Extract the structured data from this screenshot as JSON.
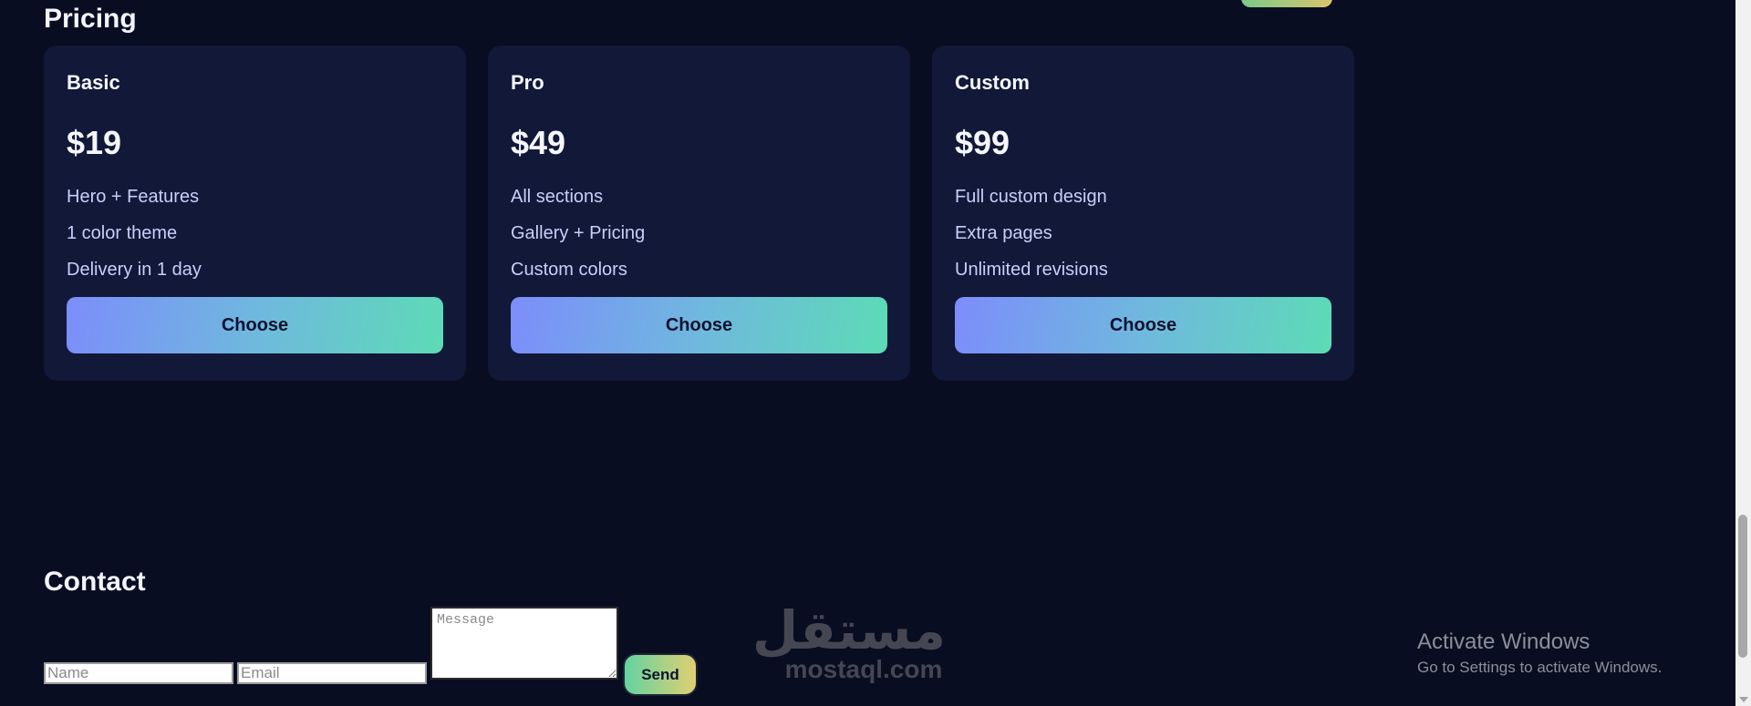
{
  "pricing": {
    "title": "Pricing",
    "plans": [
      {
        "name": "Basic",
        "price": "$19",
        "features": [
          "Hero + Features",
          "1 color theme",
          "Delivery in 1 day"
        ],
        "button": "Choose"
      },
      {
        "name": "Pro",
        "price": "$49",
        "features": [
          "All sections",
          "Gallery + Pricing",
          "Custom colors"
        ],
        "button": "Choose"
      },
      {
        "name": "Custom",
        "price": "$99",
        "features": [
          "Full custom design",
          "Extra pages",
          "Unlimited revisions"
        ],
        "button": "Choose"
      }
    ]
  },
  "contact": {
    "title": "Contact",
    "name_placeholder": "Name",
    "email_placeholder": "Email",
    "message_placeholder": "Message",
    "send_label": "Send"
  },
  "watermark": {
    "arabic": "مستقل",
    "latin": "mostaql.com"
  },
  "os_overlay": {
    "title": "Activate Windows",
    "subtitle": "Go to Settings to activate Windows."
  },
  "colors": {
    "background": "#080d22",
    "card": "#111838",
    "button_gradient_start": "#7c8dfb",
    "button_gradient_end": "#5ddbb6"
  }
}
